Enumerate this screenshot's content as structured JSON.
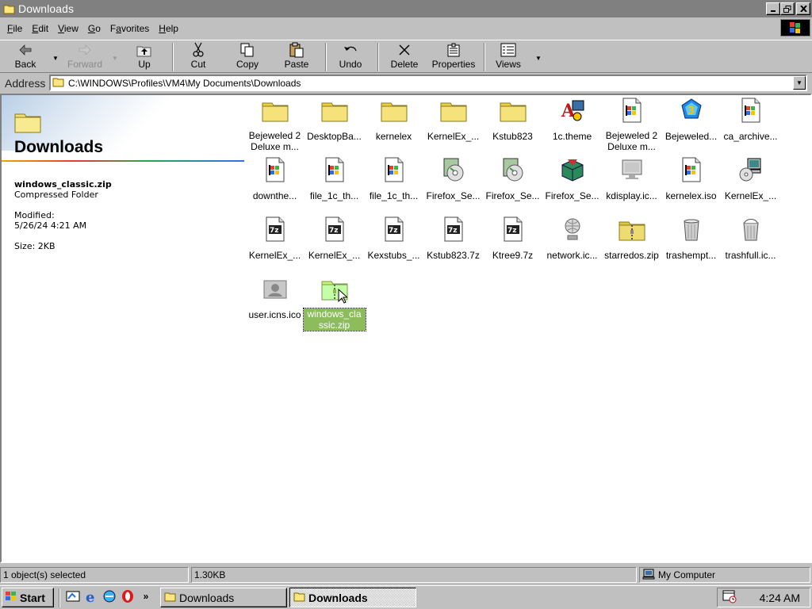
{
  "window": {
    "title": "Downloads"
  },
  "menu": [
    "File",
    "Edit",
    "View",
    "Go",
    "Favorites",
    "Help"
  ],
  "menu_underline": [
    "F",
    "E",
    "V",
    "G",
    "a",
    "H"
  ],
  "toolbar": {
    "back": "Back",
    "forward": "Forward",
    "up": "Up",
    "cut": "Cut",
    "copy": "Copy",
    "paste": "Paste",
    "undo": "Undo",
    "delete": "Delete",
    "properties": "Properties",
    "views": "Views"
  },
  "address": {
    "label": "Address",
    "path": "C:\\WINDOWS\\Profiles\\VM4\\My Documents\\Downloads"
  },
  "leftpane": {
    "title": "Downloads",
    "selected_name": "windows_classic.zip",
    "selected_type": "Compressed Folder",
    "modified_label": "Modified:",
    "modified": "5/26/24 4:21 AM",
    "size": "Size: 2KB"
  },
  "files": [
    {
      "label": "Bejeweled 2\nDeluxe m...",
      "icon": "folder-icon"
    },
    {
      "label": "DesktopBa...",
      "icon": "folder-icon"
    },
    {
      "label": "kernelex",
      "icon": "folder-icon"
    },
    {
      "label": "KernelEx_...",
      "icon": "folder-icon"
    },
    {
      "label": "Kstub823",
      "icon": "folder-icon"
    },
    {
      "label": "1c.theme",
      "icon": "theme-icon"
    },
    {
      "label": "Bejeweled 2\nDeluxe m...",
      "icon": "installer-icon"
    },
    {
      "label": "Bejeweled...",
      "icon": "bejeweled-icon"
    },
    {
      "label": "ca_archive...",
      "icon": "installer-icon"
    },
    {
      "label": "downthe...",
      "icon": "installer-icon"
    },
    {
      "label": "file_1c_th...",
      "icon": "installer-icon"
    },
    {
      "label": "file_1c_th...",
      "icon": "installer-icon"
    },
    {
      "label": "Firefox_Se...",
      "icon": "cd-setup-icon"
    },
    {
      "label": "Firefox_Se...",
      "icon": "cd-setup-icon"
    },
    {
      "label": "Firefox_Se...",
      "icon": "setup-box-icon"
    },
    {
      "label": "kdisplay.ic...",
      "icon": "display-icon"
    },
    {
      "label": "kernelex.iso",
      "icon": "installer-icon"
    },
    {
      "label": "KernelEx_...",
      "icon": "computer-cd-icon"
    },
    {
      "label": "KernelEx_...",
      "icon": "7z-archive-icon"
    },
    {
      "label": "KernelEx_...",
      "icon": "7z-archive-icon"
    },
    {
      "label": "Kexstubs_...",
      "icon": "7z-archive-icon"
    },
    {
      "label": "Kstub823.7z",
      "icon": "7z-archive-icon"
    },
    {
      "label": "Ktree9.7z",
      "icon": "7z-archive-icon"
    },
    {
      "label": "network.ic...",
      "icon": "network-icon"
    },
    {
      "label": "starredos.zip",
      "icon": "zip-folder-icon"
    },
    {
      "label": "trashempt...",
      "icon": "trash-empty-icon"
    },
    {
      "label": "trashfull.ic...",
      "icon": "trash-full-icon"
    },
    {
      "label": "user.icns.ico",
      "icon": "user-icon"
    },
    {
      "label": "windows_cla\nssic.zip",
      "icon": "zip-folder-icon"
    }
  ],
  "status": {
    "selected": "1 object(s) selected",
    "size": "1.30KB",
    "zone": "My Computer"
  },
  "taskbar": {
    "start": "Start",
    "task1": "Downloads",
    "task2": "Downloads",
    "clock": "4:24 AM"
  }
}
